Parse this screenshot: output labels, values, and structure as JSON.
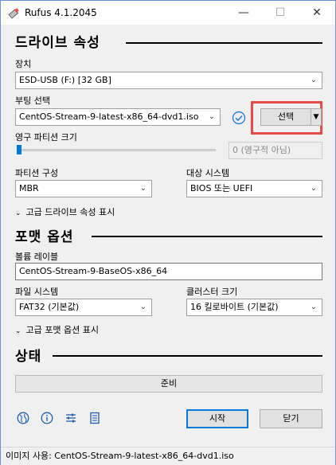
{
  "window": {
    "title": "Rufus 4.1.2045",
    "min_glyph": "—",
    "max_glyph": "☐",
    "close_glyph": "✕"
  },
  "drive_section": {
    "title": "드라이브 속성",
    "device_label": "장치",
    "device_value": "ESD-USB (F:) [32 GB]",
    "boot_label": "부팅 선택",
    "boot_value": "CentOS-Stream-9-latest-x86_64-dvd1.iso",
    "select_button": "선택",
    "persistent_label": "영구 파티션 크기",
    "persistent_value": "0 (영구적 아님)",
    "partition_label": "파티션 구성",
    "partition_value": "MBR",
    "target_label": "대상 시스템",
    "target_value": "BIOS 또는 UEFI",
    "advanced_toggle": "고급 드라이브 속성 표시"
  },
  "format_section": {
    "title": "포맷 옵션",
    "volume_label": "볼륨 레이블",
    "volume_value": "CentOS-Stream-9-BaseOS-x86_64",
    "fs_label": "파일 시스템",
    "fs_value": "FAT32 (기본값)",
    "cluster_label": "클러스터 크기",
    "cluster_value": "16 킬로바이트 (기본값)",
    "advanced_toggle": "고급 포맷 옵션 표시"
  },
  "status_section": {
    "title": "상태",
    "progress_text": "준비"
  },
  "actions": {
    "start": "시작",
    "close": "닫기"
  },
  "statusbar": {
    "text": "이미지 사용: CentOS-Stream-9-latest-x86_64-dvd1.iso"
  },
  "icons": [
    "globe-icon",
    "info-icon",
    "settings-sliders-icon",
    "log-icon"
  ],
  "colors": {
    "accent": "#0078d7",
    "highlight": "#e64a4a"
  }
}
